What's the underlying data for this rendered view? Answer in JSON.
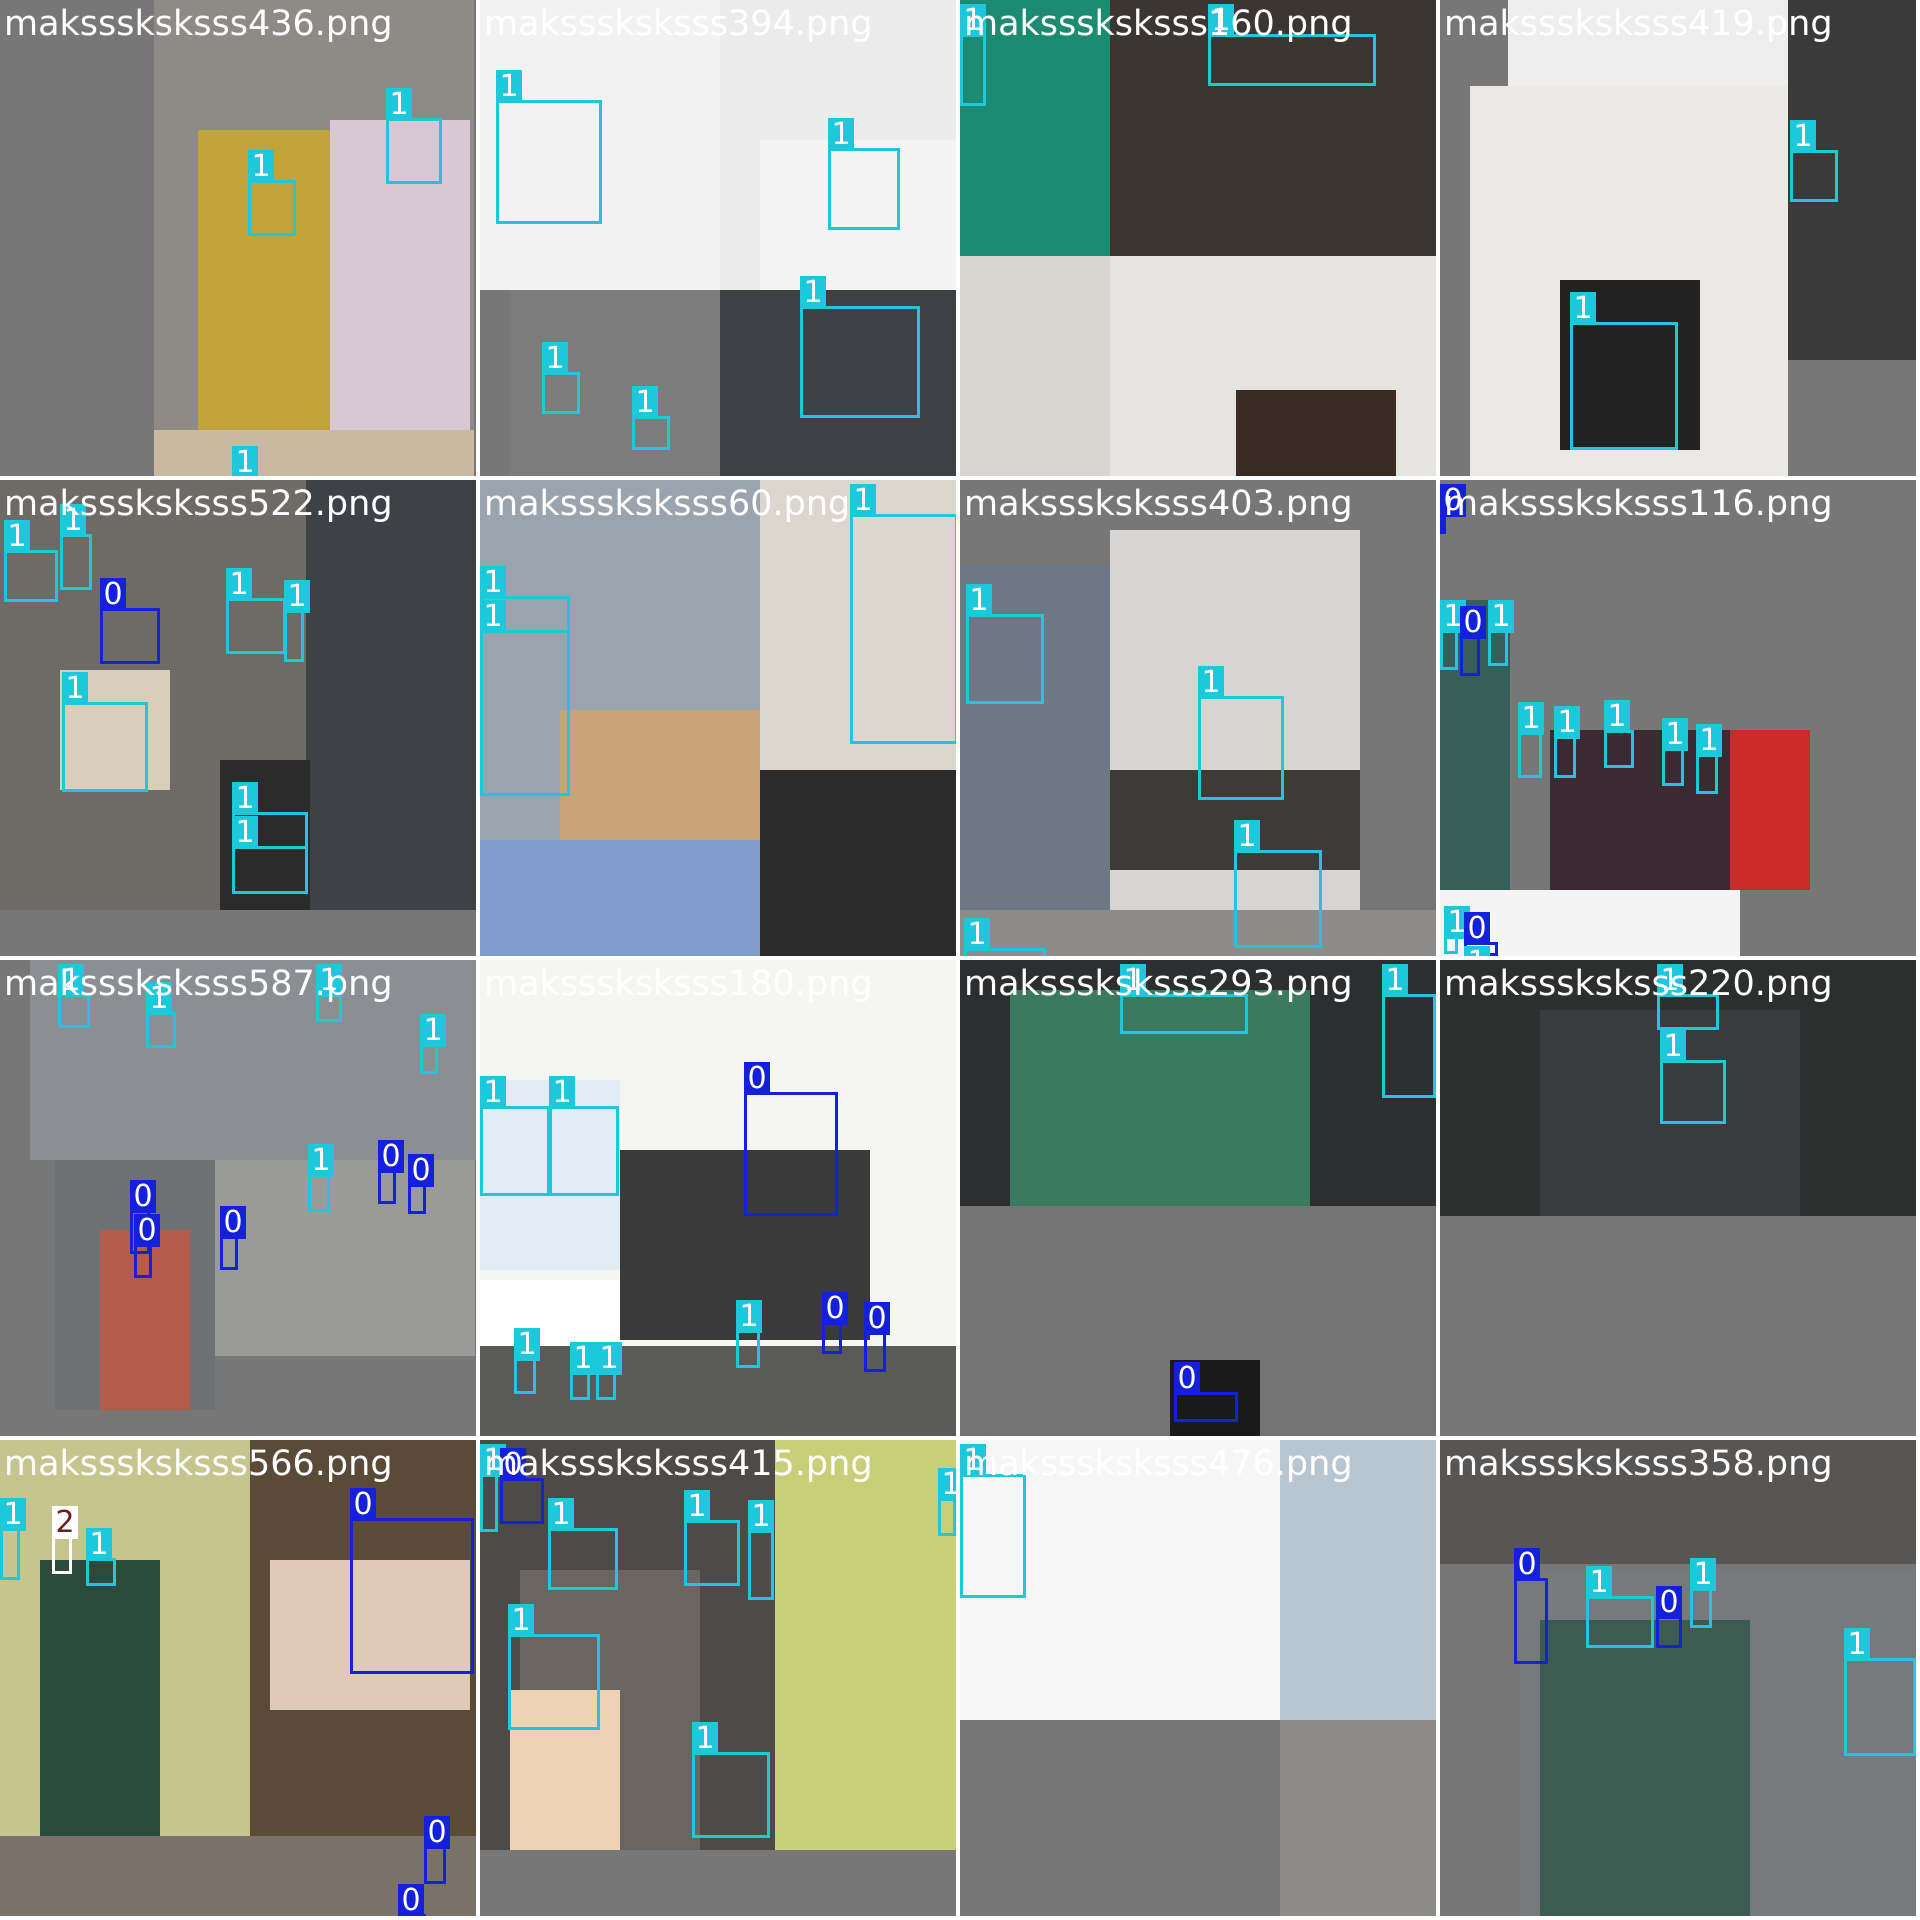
{
  "colors": {
    "background": "#777777",
    "grid_gap": "#ffffff",
    "class_0": "#1420dc",
    "class_1": "#1ec8dc",
    "class_2": "#ffffff",
    "title_text": "#ffffff"
  },
  "tiles": [
    {
      "title": "maksssksksss436.png",
      "labels": [
        "1",
        "1",
        "1"
      ]
    },
    {
      "title": "maksssksksss394.png",
      "labels": [
        "1",
        "1",
        "1",
        "1",
        "1"
      ]
    },
    {
      "title": "maksssksksss160.png",
      "labels": [
        "1",
        "1"
      ]
    },
    {
      "title": "maksssksksss419.png",
      "labels": [
        "1",
        "1"
      ]
    },
    {
      "title": "maksssksksss522.png",
      "labels": [
        "1",
        "1",
        "0",
        "1",
        "1",
        "1",
        "1",
        "1"
      ]
    },
    {
      "title": "maksssksksss60.png",
      "labels": [
        "1",
        "1",
        "1"
      ]
    },
    {
      "title": "maksssksksss403.png",
      "labels": [
        "1",
        "1",
        "1",
        "1"
      ]
    },
    {
      "title": "maksssksksss116.png",
      "labels": [
        "1",
        "0",
        "1",
        "1",
        "1",
        "1",
        "1",
        "1",
        "1",
        "0",
        "1",
        "0"
      ]
    },
    {
      "title": "maksssksksss587.png",
      "labels": [
        "1",
        "1",
        "1",
        "1",
        "1",
        "0",
        "0",
        "0",
        "0",
        "0"
      ]
    },
    {
      "title": "maksssksksss180.png",
      "labels": [
        "1",
        "1",
        "0",
        "1",
        "1",
        "1",
        "1",
        "0",
        "0"
      ]
    },
    {
      "title": "maksssksksss293.png",
      "labels": [
        "1",
        "1",
        "0"
      ]
    },
    {
      "title": "maksssksksss220.png",
      "labels": [
        "1",
        "1"
      ]
    },
    {
      "title": "maksssksksss566.png",
      "labels": [
        "1",
        "2",
        "1",
        "0",
        "0",
        "0"
      ]
    },
    {
      "title": "maksssksksss415.png",
      "labels": [
        "1",
        "0",
        "1",
        "1",
        "1",
        "1",
        "1",
        "1"
      ]
    },
    {
      "title": "maksssksksss476.png",
      "labels": [
        "1"
      ]
    },
    {
      "title": "maksssksksss358.png",
      "labels": [
        "0",
        "1",
        "0",
        "1",
        "1"
      ]
    }
  ]
}
